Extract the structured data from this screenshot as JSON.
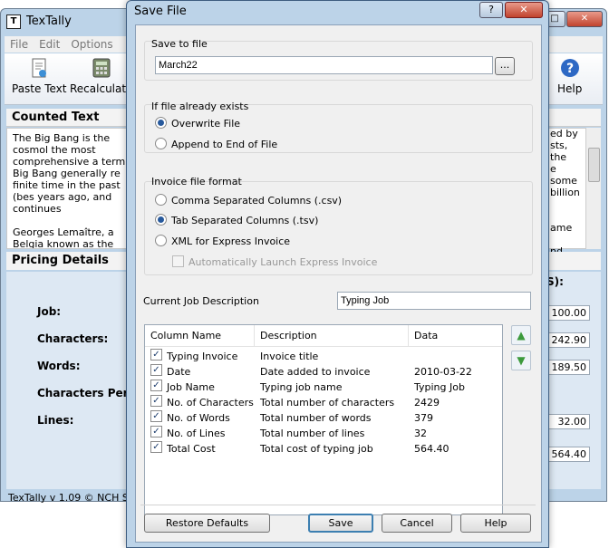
{
  "main_window": {
    "title": "TexTally",
    "menu": [
      "File",
      "Edit",
      "Options"
    ],
    "toolbar": {
      "paste_label": "Paste Text",
      "recalculate_label": "Recalculate",
      "help_label": "Help"
    },
    "counted_header": "Counted Text",
    "counted_paragraph1": "The Big Bang is the cosmol the most comprehensive a term Big Bang generally re finite time in the past (bes years ago, and continues",
    "counted_paragraph2": "Georges Lemaître, a Belgia known as the Big Bang the framework for the model r",
    "counted_right_fragments": [
      "ed by",
      "sts, the",
      "e some",
      "billion",
      "",
      "",
      "ame",
      "",
      "nd"
    ],
    "pricing_header": "Pricing Details",
    "pricing_right_fragment": "S):",
    "labels": {
      "job": "Job:",
      "characters": "Characters:",
      "words": "Words:",
      "chars_per_line": "Characters Per Lin",
      "lines": "Lines:"
    },
    "values": {
      "v1": "100.00",
      "v2": "242.90",
      "v3": "189.50",
      "v4": "32.00",
      "v5": "564.40"
    },
    "status": "TexTally v 1.09 © NCH So"
  },
  "dialog": {
    "title": "Save File",
    "title_help": "?",
    "save_to_file": {
      "label": "Save to file",
      "filename": "March22",
      "browse_label": "..."
    },
    "if_exists": {
      "label": "If file already exists",
      "options": [
        "Overwrite File",
        "Append to End of File"
      ],
      "selected": 0
    },
    "format": {
      "label": "Invoice file format",
      "options": [
        "Comma Separated Columns (.csv)",
        "Tab Separated Columns (.tsv)",
        "XML for Express Invoice"
      ],
      "selected": 1,
      "auto_launch_label": "Automatically Launch Express Invoice"
    },
    "job_description": {
      "label": "Current Job Description",
      "value": "Typing Job"
    },
    "columns": {
      "headers": [
        "Column Name",
        "Description",
        "Data"
      ],
      "rows": [
        {
          "name": "Typing Invoice",
          "description": "Invoice title",
          "data": "",
          "checked": true
        },
        {
          "name": "Date",
          "description": "Date added to invoice",
          "data": "2010-03-22",
          "checked": true
        },
        {
          "name": "Job Name",
          "description": "Typing job name",
          "data": "Typing Job",
          "checked": true
        },
        {
          "name": "No. of Characters",
          "description": "Total number of characters",
          "data": "2429",
          "checked": true
        },
        {
          "name": "No. of Words",
          "description": "Total number of words",
          "data": "379",
          "checked": true
        },
        {
          "name": "No. of Lines",
          "description": "Total number of lines",
          "data": "32",
          "checked": true
        },
        {
          "name": "Total Cost",
          "description": "Total cost of typing job",
          "data": "564.40",
          "checked": true
        }
      ]
    },
    "buttons": {
      "restore": "Restore Defaults",
      "save": "Save",
      "cancel": "Cancel",
      "help": "Help"
    }
  }
}
